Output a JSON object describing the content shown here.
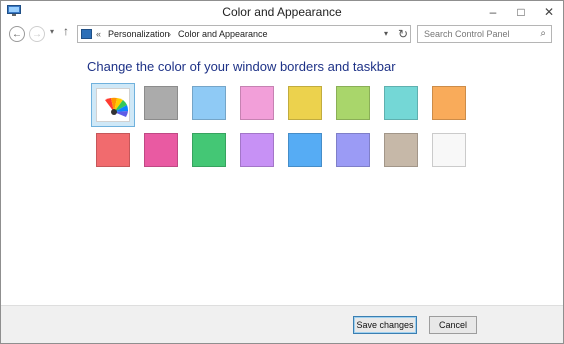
{
  "window": {
    "title": "Color and Appearance"
  },
  "nav": {
    "back_glyph": "←",
    "forward_glyph": "→",
    "recent_glyph": "▾",
    "up_glyph": "↑",
    "address_prefix": "«",
    "breadcrumb": [
      "Personalization",
      "Color and Appearance"
    ],
    "address_dropdown_glyph": "▾",
    "refresh_glyph": "↻",
    "search_placeholder": "Search Control Panel",
    "search_icon_glyph": "⌕"
  },
  "main": {
    "heading": "Change the color of your window borders and taskbar",
    "swatches": [
      {
        "color": "automatic",
        "selected": true
      },
      {
        "color": "#ababab"
      },
      {
        "color": "#8fcaf5"
      },
      {
        "color": "#f29fd9"
      },
      {
        "color": "#ecd24d"
      },
      {
        "color": "#a9d66b"
      },
      {
        "color": "#74d7d6"
      },
      {
        "color": "#f9ab5a"
      },
      {
        "color": "#f16b6e"
      },
      {
        "color": "#e95aa2"
      },
      {
        "color": "#44c775"
      },
      {
        "color": "#c791f5"
      },
      {
        "color": "#56acf4"
      },
      {
        "color": "#9b9bf5"
      },
      {
        "color": "#c6b8a8"
      },
      {
        "color": "#f8f8f8"
      }
    ]
  },
  "footer": {
    "save_label": "Save changes",
    "cancel_label": "Cancel"
  }
}
